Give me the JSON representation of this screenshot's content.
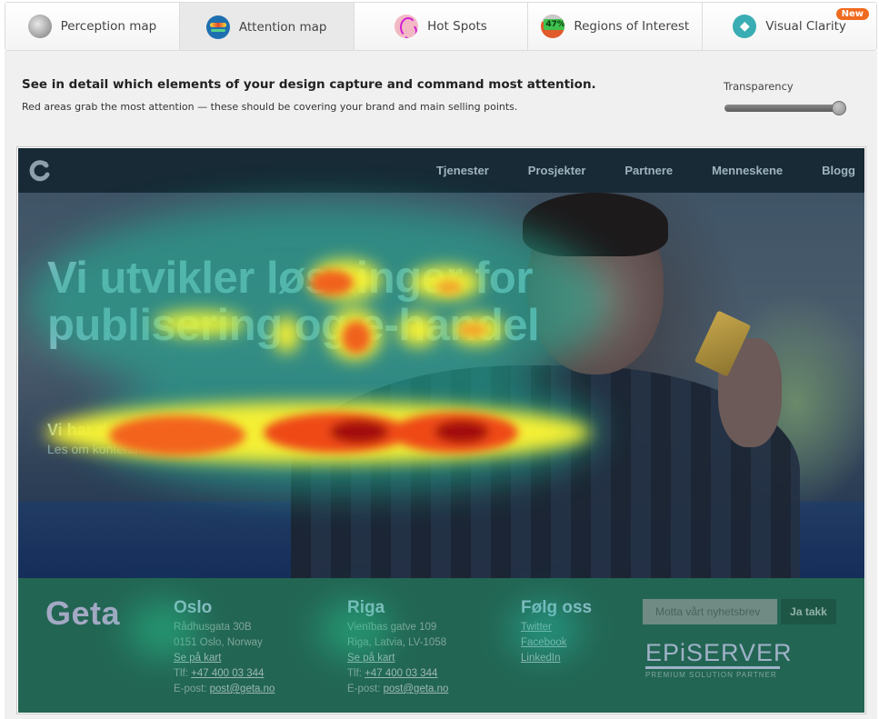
{
  "tabs": [
    {
      "label": "Perception map",
      "icon": "perception-map-icon",
      "active": false
    },
    {
      "label": "Attention map",
      "icon": "attention-map-icon",
      "active": true
    },
    {
      "label": "Hot Spots",
      "icon": "hot-spots-icon",
      "active": false
    },
    {
      "label": "Regions of Interest",
      "icon": "regions-of-interest-icon",
      "icon_text": "47%",
      "active": false
    },
    {
      "label": "Visual Clarity",
      "icon": "visual-clarity-icon",
      "badge": "New",
      "active": false
    }
  ],
  "panel": {
    "headline": "See in detail which elements of your design capture and command most attention.",
    "subline": "Red areas grab the most attention — these should be covering your brand and main selling points.",
    "transparency_label": "Transparency",
    "transparency_value": 1.0
  },
  "site": {
    "nav": [
      "Tjenester",
      "Prosjekter",
      "Partnere",
      "Menneskene",
      "Blogg"
    ],
    "hero_title_line1": "Vi utvikler løsninger for",
    "hero_title_line2": "publisering og e-handel",
    "hero_sub": "Vi har deltatt på Episerver-konferanse i Chicago.",
    "hero_link": "Les om konferansen",
    "footer": {
      "logo": "Geta",
      "oslo": {
        "title": "Oslo",
        "address1": "Rådhusgata 30B",
        "address2": "0151 Oslo, Norway",
        "map_link": "Se på kart",
        "phone_label": "Tlf:",
        "phone": "+47 400 03 344",
        "email_label": "E-post:",
        "email": "post@geta.no"
      },
      "riga": {
        "title": "Riga",
        "address1": "Vienības gatve 109",
        "address2": "Riga, Latvia, LV-1058",
        "map_link": "Se på kart",
        "phone_label": "Tlf:",
        "phone": "+47 400 03 344",
        "email_label": "E-post:",
        "email": "post@geta.no"
      },
      "follow": {
        "title": "Følg oss",
        "links": [
          "Twitter",
          "Facebook",
          "LinkedIn"
        ]
      },
      "newsletter_placeholder": "Motta vårt nyhetsbrev",
      "newsletter_button": "Ja takk",
      "partner_logo": "EPiSERVER",
      "partner_tag": "PREMIUM SOLUTION PARTNER"
    }
  },
  "colors": {
    "active_tab": "#e9e9e9",
    "badge_new": "#f06a1f",
    "site_nav": "#172a35",
    "footer": "#236553"
  }
}
